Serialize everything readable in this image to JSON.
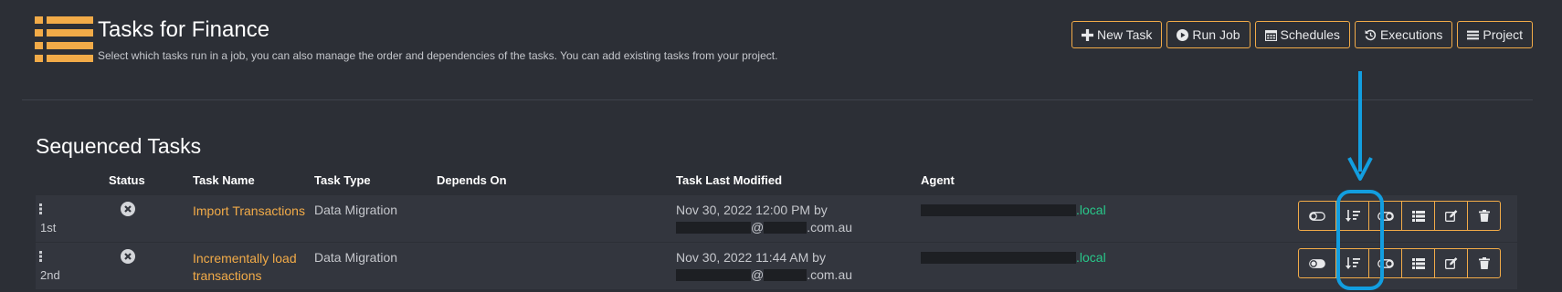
{
  "header": {
    "logo_icon": "list-icon",
    "title": "Tasks for Finance",
    "subtitle": "Select which tasks run in a job, you can also manage the order and dependencies of the tasks. You can add existing tasks from your project."
  },
  "toolbar": {
    "buttons": [
      {
        "label": "New Task",
        "icon": "plus-icon"
      },
      {
        "label": "Run Job",
        "icon": "play-circle-icon"
      },
      {
        "label": "Schedules",
        "icon": "calendar-icon"
      },
      {
        "label": "Executions",
        "icon": "history-icon"
      },
      {
        "label": "Project",
        "icon": "bars-icon"
      }
    ]
  },
  "section": {
    "title": "Sequenced Tasks"
  },
  "table": {
    "columns": [
      "Status",
      "Task Name",
      "Task Type",
      "Depends On",
      "Task Last Modified",
      "Agent"
    ],
    "rows": [
      {
        "order": "1st",
        "status_icon": "x-circle-icon",
        "task_name": "Import Transactions",
        "task_type": "Data Migration",
        "depends_on": "",
        "modified_date": "Nov 30, 2022 12:00 PM by",
        "modified_by_at": "@",
        "modified_by_domain": ".com.au",
        "agent_suffix": ".local"
      },
      {
        "order": "2nd",
        "status_icon": "x-circle-icon",
        "task_name": "Incrementally load transactions",
        "task_type": "Data Migration",
        "depends_on": "",
        "modified_date": "Nov 30, 2022 11:44 AM by",
        "modified_by_at": "@",
        "modified_by_domain": ".com.au",
        "agent_suffix": ".local"
      }
    ],
    "row_actions": [
      "toggle-icon",
      "sort-order-icon",
      "toggle-icon",
      "list-icon",
      "edit-icon",
      "trash-icon"
    ]
  },
  "colors": {
    "background": "#2c2f36",
    "accent": "#f2ab48",
    "agent_green": "#28c88a",
    "annotation_blue": "#129ee0"
  }
}
